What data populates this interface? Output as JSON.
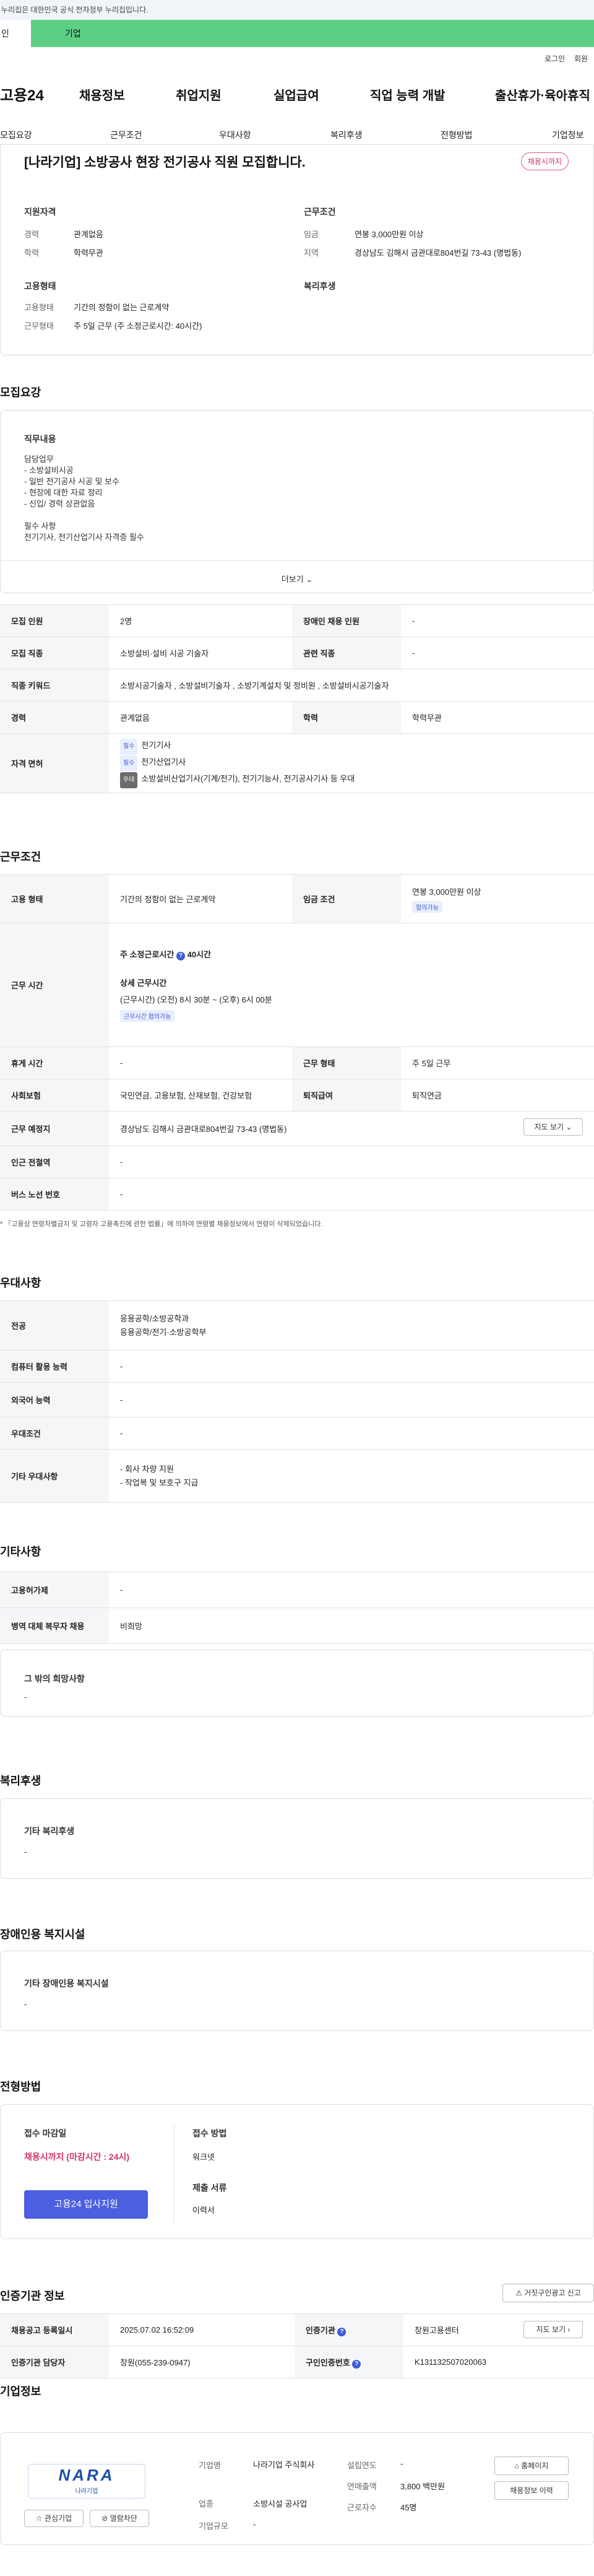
{
  "gov_notice": "누리집은 대한민국 공식 전자정부 누리집입니다.",
  "top_tabs": [
    "인",
    "기업"
  ],
  "util": {
    "login": "로그인",
    "signup": "회원"
  },
  "logo": "고용24",
  "gnb": [
    "채용정보",
    "취업지원",
    "실업급여",
    "직업 능력 개발",
    "출산휴가·육아휴직"
  ],
  "subnav": [
    "모집요강",
    "근무조건",
    "우대사항",
    "복리후생",
    "전형방법",
    "기업정보"
  ],
  "job": {
    "title": "[나라기업] 소방공사 현장 전기공사 직원 모집합니다.",
    "status": "채용시까지",
    "qual_title": "지원자격",
    "exp_label": "경력",
    "exp_value": "관계없음",
    "edu_label": "학력",
    "edu_value": "학력무관",
    "cond_title": "근무조건",
    "wage_label": "임금",
    "wage_value": "연봉 3,000만원 이상",
    "region_label": "지역",
    "region_value": "경상남도 김해시 금관대로804번길 73-43 (명법동)",
    "emp_title": "고용형태",
    "emp_type_label": "고용형태",
    "emp_type_value": "기간의 정함이 없는 근로계약",
    "work_form_label": "근무형태",
    "work_form_value": "주 5일 근무 (주 소정근로시간: 40시간)",
    "welfare_title": "복리후생"
  },
  "recruit": {
    "section": "모집요강",
    "duty_title": "직무내용",
    "duty_lines": [
      "담당업무",
      "- 소방설비시공",
      "- 일반 전기공사 시공 및 보수",
      "- 현장에 대한 자료 정리",
      "- 신입/ 경력 상관없음",
      "",
      "필수 사항",
      "전기기사, 전기산업기사 자격증 필수"
    ],
    "more": "더보기",
    "rows": {
      "count_label": "모집 인원",
      "count_value": "2명",
      "disabled_label": "장애인 채용 인원",
      "disabled_value": "-",
      "job_label": "모집 직종",
      "job_value": "소방설비·설비 시공 기술자",
      "related_label": "관련 직종",
      "related_value": "-",
      "keyword_label": "직종 키워드",
      "keyword_value": "소방시공기술자 , 소방설비기술자 , 소방기계설치 및 정비원 , 소방설비시공기술자",
      "exp_label": "경력",
      "exp_value": "관계없음",
      "edu_label": "학력",
      "edu_value": "학력무관",
      "license_label": "자격 면허",
      "licenses": [
        {
          "tag": "필수",
          "name": "전기기사"
        },
        {
          "tag": "필수",
          "name": "전기산업기사"
        },
        {
          "tag": "우대",
          "name": "소방설비산업기사(기계/전기), 전기기능사, 전기공사기사 등 우대"
        }
      ]
    }
  },
  "work": {
    "section": "근무조건",
    "emp_label": "고용 형태",
    "emp_value": "기간의 정함이 없는 근로계약",
    "wage_label": "임금 조건",
    "wage_value": "연봉 3,000만원 이상",
    "wage_chip": "협의가능",
    "hours_label": "근무 시간",
    "hours_weekly": "주 소정근로시간",
    "hours_weekly_value": "40시간",
    "hours_detail_title": "상세 근무시간",
    "hours_detail": "(근무시간) (오전) 8시 30분 ~ (오후) 6시 00분",
    "hours_chip": "근무시간 협의가능",
    "holiday_label": "휴게 시간",
    "holiday_value": "-",
    "form_label": "근무 형태",
    "form_value": "주 5일 근무",
    "insurance_label": "사회보험",
    "insurance_value": "국민연금, 고용보험, 산재보험, 건강보험",
    "retire_label": "퇴직급여",
    "retire_value": "퇴직연금",
    "place_label": "근무 예정지",
    "place_value": "경상남도 김해시 금관대로804번길 73-43 (명법동)",
    "map_btn": "지도 보기",
    "subway_label": "인근 전철역",
    "subway_value": "-",
    "bus_label": "버스 노선 번호",
    "bus_value": "-",
    "note": "* 「고용상 연령차별금지 및 고령자 고용촉진에 관한 법률」에 의하여 연령별 채용정보에서 연령이 삭제되었습니다."
  },
  "pref": {
    "section": "우대사항",
    "major_label": "전공",
    "major_value1": "응용공학/소방공학과",
    "major_value2": "응용공학/전기·소방공학부",
    "computer_label": "컴퓨터 활용 능력",
    "computer_value": "-",
    "lang_label": "외국어 능력",
    "lang_value": "-",
    "cond_label": "우대조건",
    "cond_value": "-",
    "other_label": "기타 우대사항",
    "other_value1": "- 회사 차량 지원",
    "other_value2": "- 작업복 및 보호구 지급"
  },
  "etc": {
    "section": "기타사항",
    "insured_label": "고용허가제",
    "insured_value": "-",
    "military_label": "병역 대체 복무자 채용",
    "military_value": "비희망",
    "wish_title": "그 밖의 희망사항",
    "wish_value": "-"
  },
  "welfare": {
    "section": "복리후생",
    "title": "기타 복리후생",
    "value": "-"
  },
  "disabled": {
    "section": "장애인용 복지시설",
    "title": "기타 장애인용 복지시설",
    "value": "-"
  },
  "screening": {
    "section": "전형방법",
    "deadline_label": "접수 마감일",
    "deadline_value": "채용시까지 (마감시간 : 24시)",
    "save_btn": "고용24 입사지원",
    "method_label": "접수 방법",
    "method_value": "워크넷",
    "docs_label": "제출 서류",
    "docs_value": "이력서"
  },
  "agency": {
    "section": "인증기관 정보",
    "report_btn": "거짓구인광고 신고",
    "reg_label": "채용공고 등록일시",
    "reg_value": "2025.07.02 16:52:09",
    "org_label": "인증기관",
    "org_value": "창원고용센터",
    "map_btn": "지도 보기",
    "manager_label": "인증기관 담당자",
    "manager_value": "창원(055-239-0947)",
    "job_no_label": "구인인증번호",
    "job_no_value": "K131132507020063"
  },
  "company": {
    "section": "기업정보",
    "logo_text": "NARA",
    "logo_sub": "나라기업",
    "interest_btn": "관심기업",
    "block_btn": "열람차단",
    "name_label": "기업명",
    "name_value": "나라기업 주식회사",
    "industry_label": "업종",
    "industry_value": "소방시설 공사업",
    "size_label": "기업규모",
    "size_value": "-",
    "founded_label": "설립연도",
    "founded_value": "-",
    "sales_label": "연매출액",
    "sales_value": "3,800 백만원",
    "staff_label": "근로자수",
    "staff_value": "45명",
    "home_btn": "홈페이지",
    "more_btn": "채용정보 이력"
  }
}
